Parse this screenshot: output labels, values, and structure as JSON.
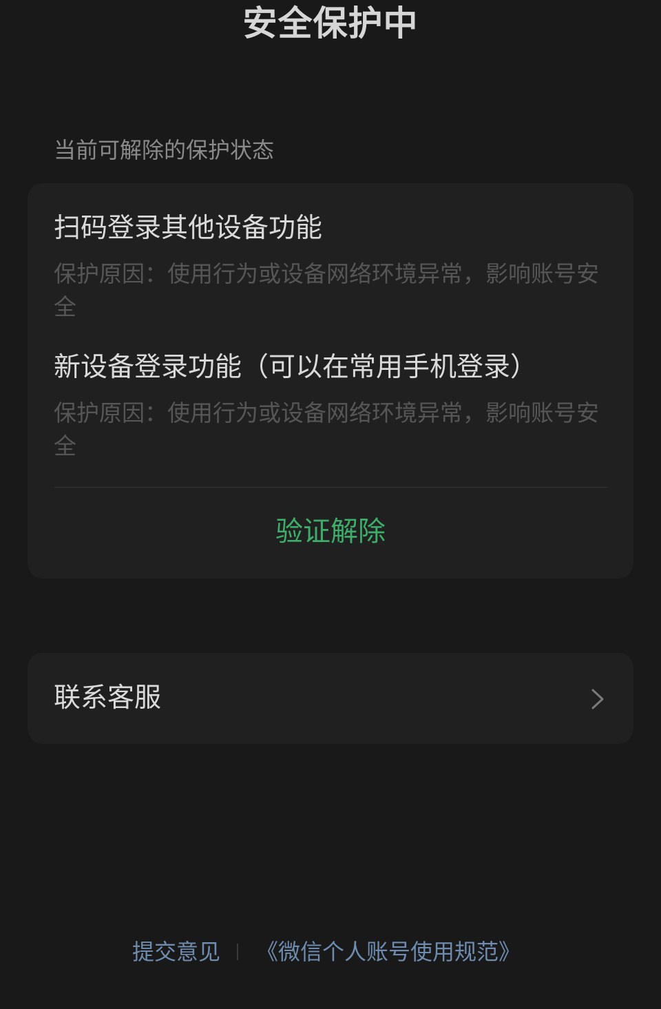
{
  "header": {
    "title": "安全保护中"
  },
  "protection": {
    "section_label": "当前可解除的保护状态",
    "items": [
      {
        "title": "扫码登录其他设备功能",
        "reason": "保护原因：使用行为或设备网络环境异常，影响账号安全"
      },
      {
        "title": "新设备登录功能（可以在常用手机登录）",
        "reason": "保护原因：使用行为或设备网络环境异常，影响账号安全"
      }
    ],
    "verify_label": "验证解除"
  },
  "service": {
    "label": "联系客服",
    "icon": "chevron-right-icon"
  },
  "footer": {
    "feedback_label": "提交意见",
    "terms_label": "《微信个人账号使用规范》"
  },
  "colors": {
    "background": "#191919",
    "card": "#202020",
    "accent_green": "#3ead69",
    "link_blue": "#6e8bb0"
  }
}
